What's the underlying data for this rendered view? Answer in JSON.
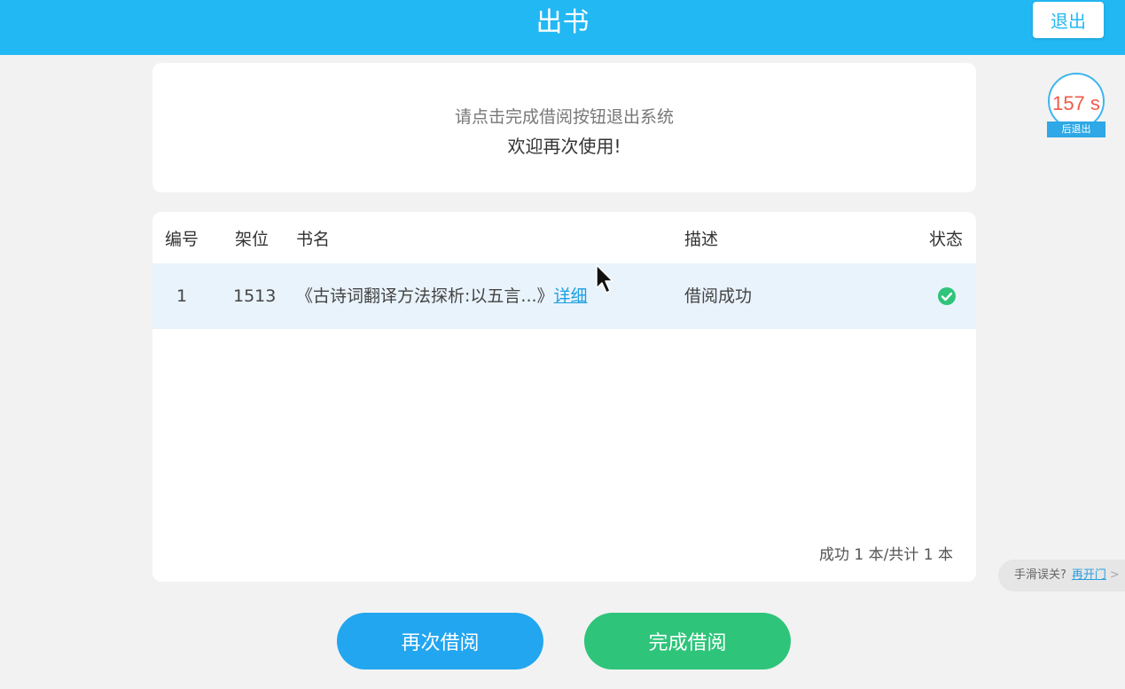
{
  "header": {
    "title": "出书",
    "logout_label": "退出"
  },
  "timer": {
    "value": "157 s",
    "label": "后退出"
  },
  "message": {
    "line1": "请点击完成借阅按钮退出系统",
    "line2": "欢迎再次使用!"
  },
  "table": {
    "headers": [
      "编号",
      "架位",
      "书名",
      "描述",
      "状态"
    ],
    "rows": [
      {
        "number": "1",
        "shelf": "1513",
        "title": "《古诗词翻译方法探析:以五言...》",
        "detail": "详细",
        "description": "借阅成功",
        "status_icon": "check-circle-icon"
      }
    ],
    "summary": "成功 1 本/共计 1 本"
  },
  "buttons": {
    "borrow_again": "再次借阅",
    "finish": "完成借阅"
  },
  "reopen": {
    "prompt": "手滑误关?",
    "link": "再开门",
    "chevron": ">"
  },
  "colors": {
    "header": "#22b8f3",
    "borrow_again": "#22a6f0",
    "finish": "#2ec47a",
    "success": "#2ec47a",
    "timer_value": "#f05a4a"
  }
}
